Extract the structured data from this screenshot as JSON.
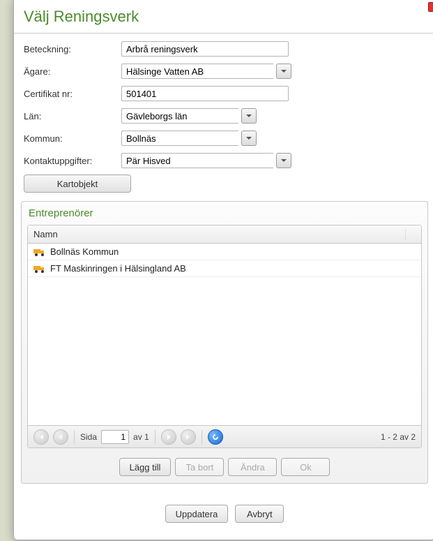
{
  "dialog": {
    "title": "Välj Reningsverk"
  },
  "form": {
    "labels": {
      "beteckning": "Beteckning:",
      "agare": "Ägare:",
      "certifikat": "Certifikat nr:",
      "lan": "Län:",
      "kommun": "Kommun:",
      "kontakt": "Kontaktuppgifter:"
    },
    "values": {
      "beteckning": "Arbrå reningsverk",
      "agare": "Hälsinge Vatten AB",
      "certifikat": "501401",
      "lan": "Gävleborgs län",
      "kommun": "Bollnäs",
      "kontakt": "Pär Hisved"
    },
    "kart_button": "Kartobjekt"
  },
  "panel": {
    "title": "Entreprenörer",
    "column_header": "Namn",
    "rows": [
      {
        "name": "Bollnäs Kommun"
      },
      {
        "name": "FT Maskinringen i Hälsingland AB"
      }
    ],
    "pager": {
      "sida_label": "Sida",
      "page": "1",
      "av_label": "av 1",
      "count_label": "1 - 2 av 2"
    },
    "actions": {
      "add": "Lägg till",
      "remove": "Ta bort",
      "edit": "Ändra",
      "ok": "Ok"
    }
  },
  "dialog_actions": {
    "update": "Uppdatera",
    "cancel": "Avbryt"
  }
}
